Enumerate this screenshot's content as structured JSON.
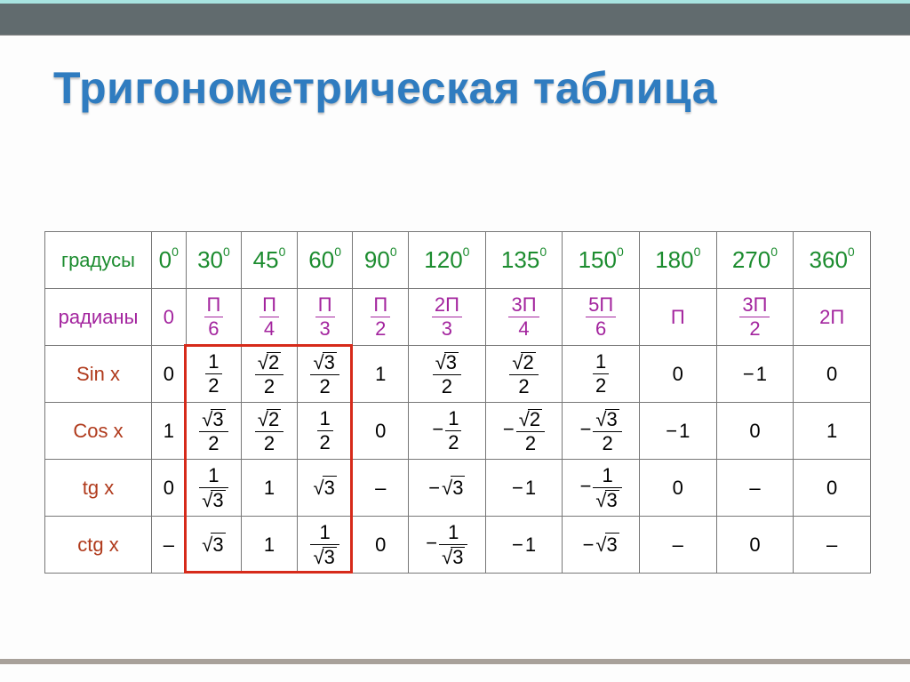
{
  "title": "Тригонометрическая таблица",
  "rows": {
    "degrees": "градусы",
    "radians": "радианы",
    "sin": "Sin x",
    "cos": "Cos x",
    "tg": "tg x",
    "ctg": "ctg x"
  },
  "degrees": [
    "0⁰",
    "30⁰",
    "45⁰",
    "60⁰",
    "90⁰",
    "120⁰",
    "135⁰",
    "150⁰",
    "180⁰",
    "270⁰",
    "360⁰"
  ],
  "radians": [
    "0",
    "П/6",
    "П/4",
    "П/3",
    "П/2",
    "2П/3",
    "3П/4",
    "5П/6",
    "П",
    "3П/2",
    "2П"
  ],
  "sin": [
    "0",
    "1/2",
    "√2/2",
    "√3/2",
    "1",
    "√3/2",
    "√2/2",
    "1/2",
    "0",
    "-1",
    "0"
  ],
  "cos": [
    "1",
    "√3/2",
    "√2/2",
    "1/2",
    "0",
    "-1/2",
    "-√2/2",
    "-√3/2",
    "-1",
    "0",
    "1"
  ],
  "tg": [
    "0",
    "1/√3",
    "1",
    "√3",
    "–",
    "-√3",
    "-1",
    "-1/√3",
    "0",
    "–",
    "0"
  ],
  "ctg": [
    "–",
    "√3",
    "1",
    "1/√3",
    "0",
    "-1/√3",
    "-1",
    "-√3",
    "–",
    "0",
    "–"
  ],
  "chart_data": {
    "type": "table",
    "title": "Тригонометрическая таблица",
    "columns_degrees": [
      0,
      30,
      45,
      60,
      90,
      120,
      135,
      150,
      180,
      270,
      360
    ],
    "columns_radians": [
      "0",
      "π/6",
      "π/4",
      "π/3",
      "π/2",
      "2π/3",
      "3π/4",
      "5π/6",
      "π",
      "3π/2",
      "2π"
    ],
    "series": [
      {
        "name": "sin x",
        "values": [
          "0",
          "1/2",
          "√2/2",
          "√3/2",
          "1",
          "√3/2",
          "√2/2",
          "1/2",
          "0",
          "-1",
          "0"
        ]
      },
      {
        "name": "cos x",
        "values": [
          "1",
          "√3/2",
          "√2/2",
          "1/2",
          "0",
          "-1/2",
          "-√2/2",
          "-√3/2",
          "-1",
          "0",
          "1"
        ]
      },
      {
        "name": "tg x",
        "values": [
          "0",
          "1/√3",
          "1",
          "√3",
          "–",
          "-√3",
          "-1",
          "-1/√3",
          "0",
          "–",
          "0"
        ]
      },
      {
        "name": "ctg x",
        "values": [
          "–",
          "√3",
          "1",
          "1/√3",
          "0",
          "-1/√3",
          "-1",
          "-√3",
          "–",
          "0",
          "–"
        ]
      }
    ],
    "highlighted_columns_deg": [
      30,
      45,
      60
    ],
    "highlighted_rows": [
      "sin x",
      "cos x",
      "tg x",
      "ctg x"
    ]
  }
}
